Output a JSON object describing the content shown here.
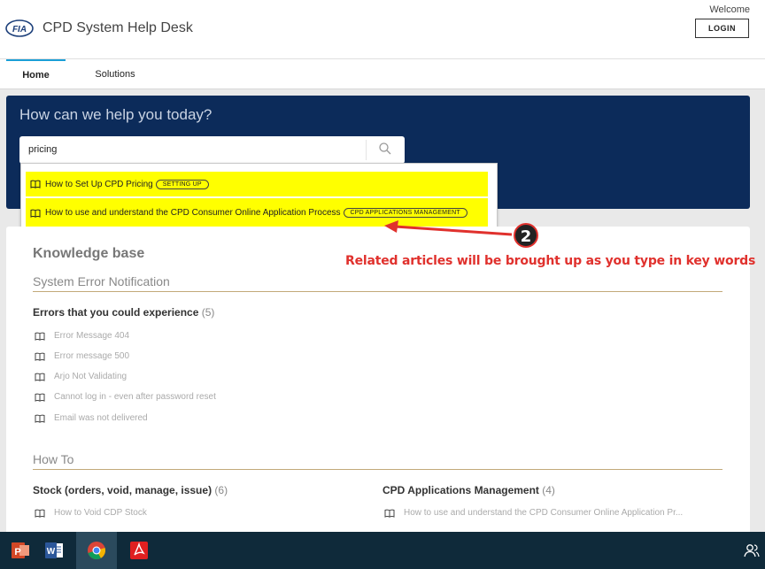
{
  "header": {
    "logo_text": "FIA",
    "app_title": "CPD System Help Desk",
    "welcome": "Welcome",
    "login_label": "LOGIN"
  },
  "nav": {
    "tabs": [
      {
        "label": "Home",
        "active": true
      },
      {
        "label": "Solutions",
        "active": false
      }
    ]
  },
  "hero": {
    "title": "How can we help you today?",
    "search_value": "pricing",
    "search_icon": "magnifier-icon"
  },
  "suggestions": [
    {
      "title": "How to Set Up CPD Pricing",
      "badge": "SETTING UP"
    },
    {
      "title": "How to use and understand the CPD Consumer Online Application Process",
      "badge": "CPD APPLICATIONS MANAGEMENT"
    }
  ],
  "annotation": {
    "number": "2",
    "text": "Related articles will be brought up as you type in key words",
    "color": "#e0312d"
  },
  "knowledge_base": {
    "title": "Knowledge base",
    "sections": [
      {
        "title": "System Error Notification",
        "categories": [
          {
            "title": "Errors that you could experience",
            "count": "(5)",
            "articles": [
              "Error Message 404",
              "Error message 500",
              "Arjo Not Validating",
              "Cannot log in - even after password reset",
              "Email was not delivered"
            ]
          }
        ]
      },
      {
        "title": "How To",
        "categories": [
          {
            "title": "Stock (orders, void, manage, issue)",
            "count": "(6)",
            "articles": [
              "How to Void CDP Stock"
            ]
          },
          {
            "title": "CPD Applications Management",
            "count": "(4)",
            "articles": [
              "How to use and understand the CPD Consumer Online Application Pr..."
            ]
          }
        ]
      }
    ]
  },
  "taskbar": {
    "apps": [
      "powerpoint-icon",
      "word-icon",
      "chrome-icon",
      "acrobat-icon"
    ],
    "active_app": "chrome-icon"
  },
  "colors": {
    "hero_bg": "#0c2b5a",
    "highlight": "#ffff00",
    "tab_accent": "#1a9fd7",
    "rule": "#c2a97a"
  }
}
